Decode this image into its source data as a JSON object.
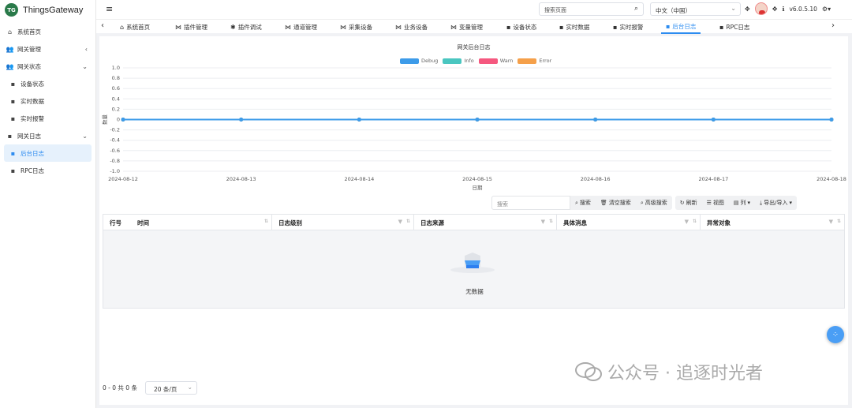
{
  "app": {
    "logo_text": "TG",
    "name": "ThingsGateway"
  },
  "sidebar": {
    "items": [
      {
        "label": "系统首页",
        "icon": "home-icon"
      },
      {
        "label": "网关管理",
        "icon": "group-icon"
      },
      {
        "label": "网关状态",
        "icon": "group-icon"
      },
      {
        "label": "设备状态",
        "icon": "book-icon"
      },
      {
        "label": "实时数据",
        "icon": "book-icon"
      },
      {
        "label": "实时报警",
        "icon": "book-icon"
      },
      {
        "label": "网关日志",
        "icon": "book-icon"
      },
      {
        "label": "后台日志",
        "icon": "book-icon"
      },
      {
        "label": "RPC日志",
        "icon": "book-icon"
      }
    ]
  },
  "topbar": {
    "search_placeholder": "搜索页面",
    "language": "中文（中国）",
    "version": "v6.0.5.10"
  },
  "tabs": [
    {
      "label": "系统首页",
      "icon": "home-icon"
    },
    {
      "label": "插件管理",
      "icon": "plugin-icon"
    },
    {
      "label": "插件调试",
      "icon": "bug-icon"
    },
    {
      "label": "通道管理",
      "icon": "plugin-icon"
    },
    {
      "label": "采集设备",
      "icon": "plugin-icon"
    },
    {
      "label": "业务设备",
      "icon": "plugin-icon"
    },
    {
      "label": "变量管理",
      "icon": "plugin-icon"
    },
    {
      "label": "设备状态",
      "icon": "book-icon"
    },
    {
      "label": "实时数据",
      "icon": "book-icon"
    },
    {
      "label": "实时报警",
      "icon": "book-icon"
    },
    {
      "label": "后台日志",
      "icon": "book-icon"
    },
    {
      "label": "RPC日志",
      "icon": "book-icon"
    }
  ],
  "chart_data": {
    "type": "line",
    "title": "网关后台日志",
    "xlabel": "日期",
    "ylabel": "数量",
    "x": [
      "2024-08-12",
      "2024-08-13",
      "2024-08-14",
      "2024-08-15",
      "2024-08-16",
      "2024-08-17",
      "2024-08-18"
    ],
    "y_ticks": [
      "1.0",
      "0.8",
      "0.6",
      "0.4",
      "0.2",
      "0",
      "-0.2",
      "-0.4",
      "-0.6",
      "-0.8",
      "-1.0"
    ],
    "ylim": [
      -1,
      1
    ],
    "grid": true,
    "legend_position": "top",
    "series": [
      {
        "name": "Debug",
        "color": "#3d9be9",
        "values": [
          0,
          0,
          0,
          0,
          0,
          0,
          0
        ]
      },
      {
        "name": "Info",
        "color": "#4ac6c0",
        "values": [
          0,
          0,
          0,
          0,
          0,
          0,
          0
        ]
      },
      {
        "name": "Warn",
        "color": "#f5587f",
        "values": [
          0,
          0,
          0,
          0,
          0,
          0,
          0
        ]
      },
      {
        "name": "Error",
        "color": "#f5a04a",
        "values": [
          0,
          0,
          0,
          0,
          0,
          0,
          0
        ]
      }
    ]
  },
  "toolbar": {
    "search_placeholder": "搜索",
    "search": "搜索",
    "clear_search": "清空搜索",
    "advanced_search": "高级搜索",
    "refresh": "刷新",
    "view": "视图",
    "columns": "列",
    "export_import": "导出/导入"
  },
  "table": {
    "columns": [
      "行号",
      "时间",
      "日志级别",
      "日志来源",
      "具体消息",
      "异常对象"
    ],
    "empty_text": "无数据"
  },
  "pager": {
    "summary": "0 - 0 共 0 条",
    "page_size": "20 条/页"
  },
  "watermark": {
    "text": "公众号 · 追逐时光者"
  }
}
